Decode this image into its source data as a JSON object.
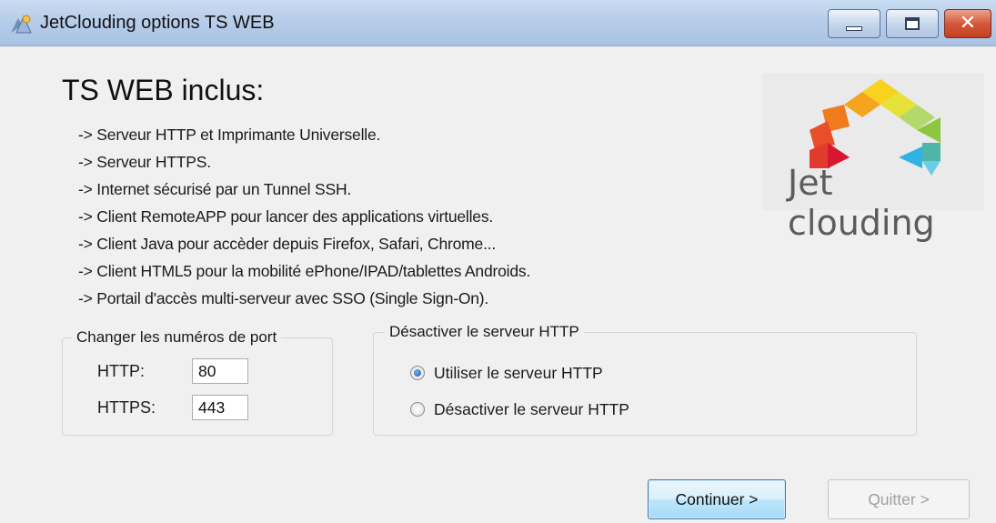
{
  "window": {
    "title": "JetClouding options TS WEB",
    "close_glyph": "✕"
  },
  "heading": "TS WEB inclus:",
  "features": [
    "-> Serveur HTTP et Imprimante Universelle.",
    "-> Serveur HTTPS.",
    "-> Internet sécurisé par un Tunnel SSH.",
    "-> Client RemoteAPP pour lancer des applications virtuelles.",
    "-> Client Java pour accèder depuis Firefox, Safari, Chrome...",
    "-> Client HTML5 pour la mobilité ePhone/IPAD/tablettes Androids.",
    "-> Portail d'accès multi-serveur avec SSO (Single Sign-On)."
  ],
  "logo": {
    "text": "Jet clouding",
    "colors": [
      "#f5c518",
      "#f39a1e",
      "#e94e2a",
      "#d7172f",
      "#8dc63f",
      "#2fb3e3",
      "#b5d86a"
    ]
  },
  "ports": {
    "legend": "Changer les numéros de port",
    "http_label": "HTTP:",
    "http_value": "80",
    "https_label": "HTTPS:",
    "https_value": "443"
  },
  "http_server": {
    "legend": "Désactiver le serveur HTTP",
    "options": [
      {
        "label": "Utiliser le serveur HTTP",
        "selected": true
      },
      {
        "label": "Désactiver le serveur HTTP",
        "selected": false
      }
    ]
  },
  "buttons": {
    "continue": "Continuer >",
    "quit": "Quitter >"
  }
}
